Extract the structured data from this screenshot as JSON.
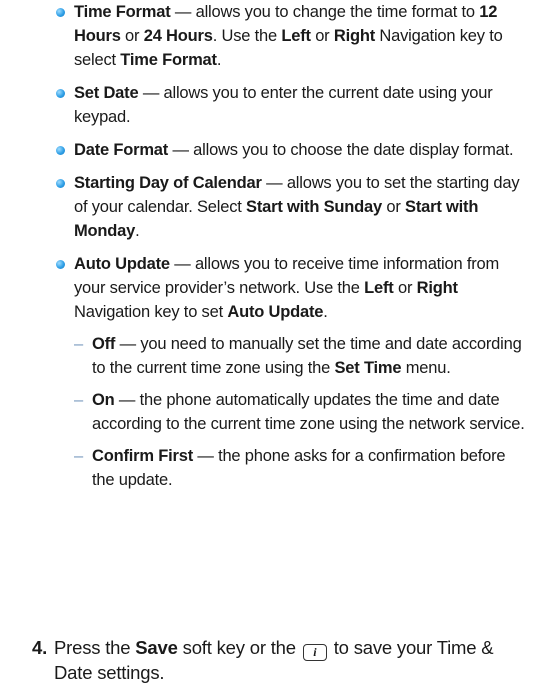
{
  "bullets": [
    {
      "term": "Time Format",
      "dash": " — ",
      "text": [
        "allows you to change the time format to ",
        "12 Hours",
        " or ",
        "24 Hours",
        ". Use the ",
        "Left",
        " or ",
        "Right",
        " Navigation key to select ",
        "Time Format",
        "."
      ]
    },
    {
      "term": "Set Date",
      "dash": " — ",
      "text": [
        "allows you to enter the current date using your keypad."
      ]
    },
    {
      "term": "Date Format",
      "dash": " — ",
      "text": [
        "allows you to choose the date display format."
      ]
    },
    {
      "term": "Starting Day of Calendar",
      "dash": " — ",
      "text": [
        "allows you to set the starting day of your calendar. Select ",
        "Start with Sunday",
        " or ",
        "Start with Monday",
        "."
      ]
    },
    {
      "term": "Auto Update",
      "dash": " — ",
      "text": [
        "allows you to receive time information from your service provider’s network. Use the ",
        "Left",
        " or ",
        "Right",
        " Navigation key to set ",
        "Auto Update",
        "."
      ]
    }
  ],
  "sub_options": [
    {
      "term": "Off",
      "dash": " — ",
      "text": [
        "you need to manually set the time and date according to the current time zone using the ",
        "Set Time",
        " menu."
      ]
    },
    {
      "term": "On",
      "dash": " — ",
      "text": [
        "the phone automatically updates the time and date according to the current time zone using the network service."
      ]
    },
    {
      "term": "Confirm First",
      "dash": " — ",
      "text": [
        "the phone asks for a confirmation before the update."
      ]
    }
  ],
  "step": {
    "number": "4.",
    "text": [
      "Press the ",
      "Save",
      " soft key or the ",
      " to save your Time & Date settings."
    ],
    "key_icon": "i-key-icon",
    "key_glyph": "i"
  }
}
